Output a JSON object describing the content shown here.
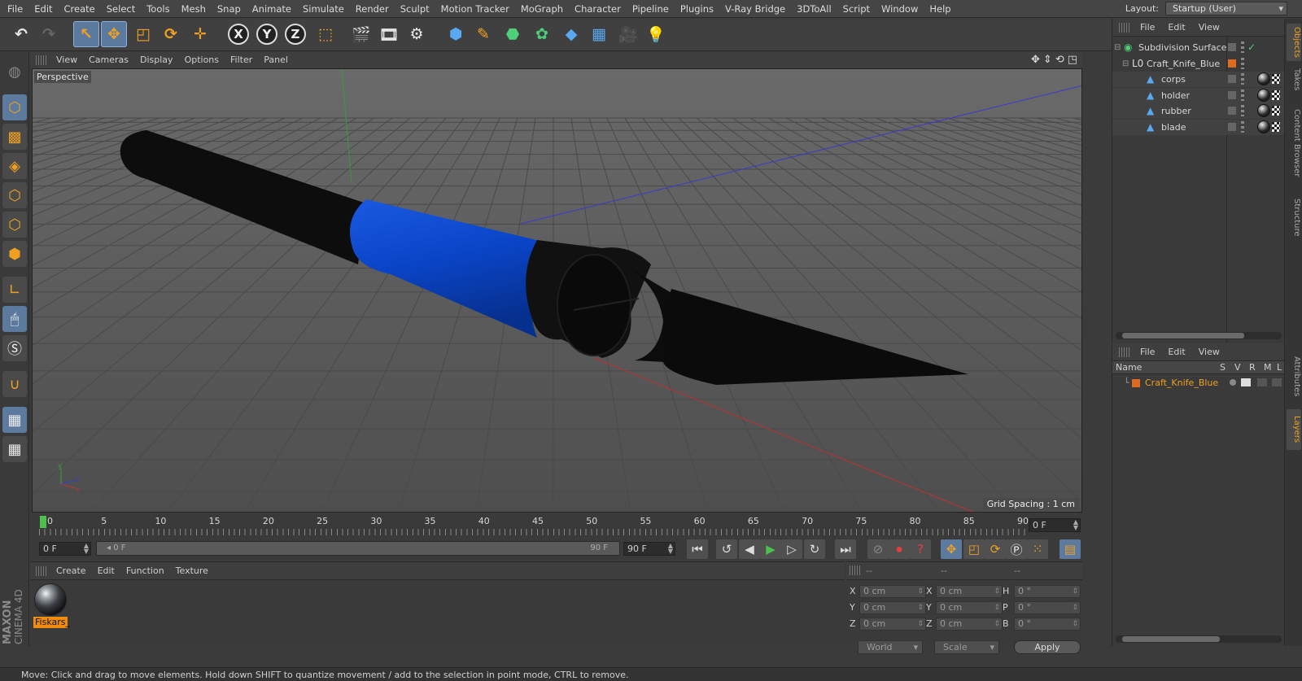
{
  "menu": [
    "File",
    "Edit",
    "Create",
    "Select",
    "Tools",
    "Mesh",
    "Snap",
    "Animate",
    "Simulate",
    "Render",
    "Sculpt",
    "Motion Tracker",
    "MoGraph",
    "Character",
    "Pipeline",
    "Plugins",
    "V-Ray Bridge",
    "3DToAll",
    "Script",
    "Window",
    "Help"
  ],
  "layout": {
    "label": "Layout:",
    "value": "Startup (User)"
  },
  "toolbar": {
    "x_axis": "X",
    "y_axis": "Y",
    "z_axis": "Z"
  },
  "viewport": {
    "menu": [
      "View",
      "Cameras",
      "Display",
      "Options",
      "Filter",
      "Panel"
    ],
    "camera_label": "Perspective",
    "grid_spacing": "Grid Spacing : 1 cm"
  },
  "timeline": {
    "ticks": [
      "0",
      "5",
      "10",
      "15",
      "20",
      "25",
      "30",
      "35",
      "40",
      "45",
      "50",
      "55",
      "60",
      "65",
      "70",
      "75",
      "80",
      "85",
      "90"
    ],
    "current_frame": "0 F",
    "start_field": "0 F",
    "slider_start": "0 F",
    "slider_end": "90 F",
    "end_field": "90 F"
  },
  "material_panel": {
    "menu": [
      "Create",
      "Edit",
      "Function",
      "Texture"
    ],
    "material_name": "Fiskars_"
  },
  "coords": {
    "header": [
      "--",
      "--",
      "--"
    ],
    "rows": [
      {
        "l1": "X",
        "v1": "0 cm",
        "l2": "X",
        "v2": "0 cm",
        "l3": "H",
        "v3": "0 °"
      },
      {
        "l1": "Y",
        "v1": "0 cm",
        "l2": "Y",
        "v2": "0 cm",
        "l3": "P",
        "v3": "0 °"
      },
      {
        "l1": "Z",
        "v1": "0 cm",
        "l2": "Z",
        "v2": "0 cm",
        "l3": "B",
        "v3": "0 °"
      }
    ],
    "space": "World",
    "mode": "Scale",
    "apply": "Apply"
  },
  "status": "Move: Click and drag to move elements. Hold down SHIFT to quantize movement / add to the selection in point mode, CTRL to remove.",
  "objects_panel": {
    "menu": [
      "File",
      "Edit",
      "View"
    ],
    "items": [
      {
        "name": "Subdivision Surface"
      },
      {
        "name": "Craft_Knife_Blue"
      },
      {
        "name": "corps"
      },
      {
        "name": "holder"
      },
      {
        "name": "rubber"
      },
      {
        "name": "blade"
      }
    ]
  },
  "layers_panel": {
    "menu": [
      "File",
      "Edit",
      "View"
    ],
    "columns": [
      "Name",
      "S",
      "V",
      "R",
      "M",
      "L"
    ],
    "layer_name": "Craft_Knife_Blue"
  },
  "side_tabs": [
    "Objects",
    "Takes",
    "Content Browser",
    "Structure",
    "Attributes",
    "Layers"
  ],
  "brand": {
    "maker": "MAXON",
    "product": "CINEMA 4D"
  },
  "colors": {
    "accent": "#f0a020",
    "selection": "#5c7a9e",
    "knife_blue": "#0a45c8",
    "knife_black": "#0b0b0b",
    "viewport_bg": "#5a5a5a",
    "layer_color": "#e06a20"
  }
}
